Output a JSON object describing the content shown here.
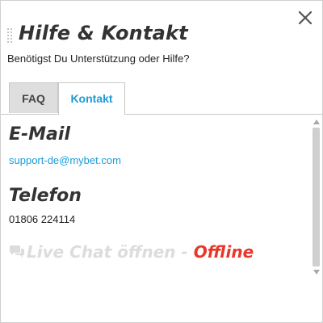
{
  "header": {
    "title": "Hilfe & Kontakt",
    "subtitle": "Benötigst Du Unterstützung oder Hilfe?"
  },
  "tabs": [
    {
      "label": "FAQ",
      "active": false
    },
    {
      "label": "Kontakt",
      "active": true
    }
  ],
  "contact": {
    "email_title": "E-Mail",
    "email_address": "support-de@mybet.com",
    "phone_title": "Telefon",
    "phone_number": "01806 224114",
    "live_chat_label": "Live Chat öffnen - ",
    "live_chat_status": "Offline"
  },
  "icons": {
    "close": "close-icon",
    "drag": "drag-handle-icon",
    "chat": "chat-bubble-icon"
  },
  "colors": {
    "accent": "#1b9bd8",
    "offline": "#e8362a",
    "title_text": "#333333",
    "disabled_text": "#dcdcdc",
    "tab_inactive_bg": "#dedede"
  }
}
